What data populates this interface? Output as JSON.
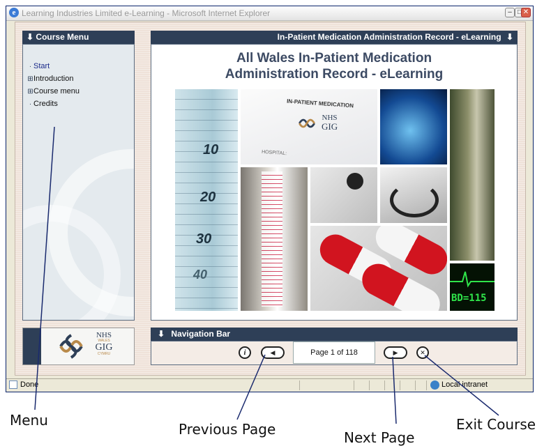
{
  "window": {
    "title": "Learning Industries Limited e-Learning - Microsoft Internet Explorer"
  },
  "menu": {
    "header": "Course Menu",
    "items": [
      {
        "marker": "·",
        "label": "Start"
      },
      {
        "marker": "⊞",
        "label": "Introduction"
      },
      {
        "marker": "⊞",
        "label": "Course menu"
      },
      {
        "marker": "·",
        "label": "Credits"
      }
    ]
  },
  "main": {
    "header": "In-Patient Medication Administration Record - eLearning",
    "title_line1": "All Wales In-Patient Medication",
    "title_line2": "Administration Record - eLearning",
    "form_label": "IN-PATIENT MEDICATION",
    "form_hospital": "HOSPITAL:",
    "syringe_marks": [
      "10",
      "20",
      "30",
      "40"
    ],
    "monitor_reading": "BD=115"
  },
  "logo": {
    "nhs": "NHS",
    "wales": "WALES",
    "gig": "GIG",
    "cymru": "CYMRU"
  },
  "nav": {
    "header": "Navigation Bar",
    "page_indicator": "Page 1 of 118",
    "info_symbol": "i"
  },
  "status": {
    "left": "Done",
    "zone": "Local intranet"
  },
  "annotations": {
    "menu": "Menu",
    "previous": "Previous Page",
    "next": "Next Page",
    "exit": "Exit Course"
  },
  "colors": {
    "panel_header": "#2e3f57",
    "title_text": "#3c4a63",
    "content_bg": "#efe2d9"
  }
}
